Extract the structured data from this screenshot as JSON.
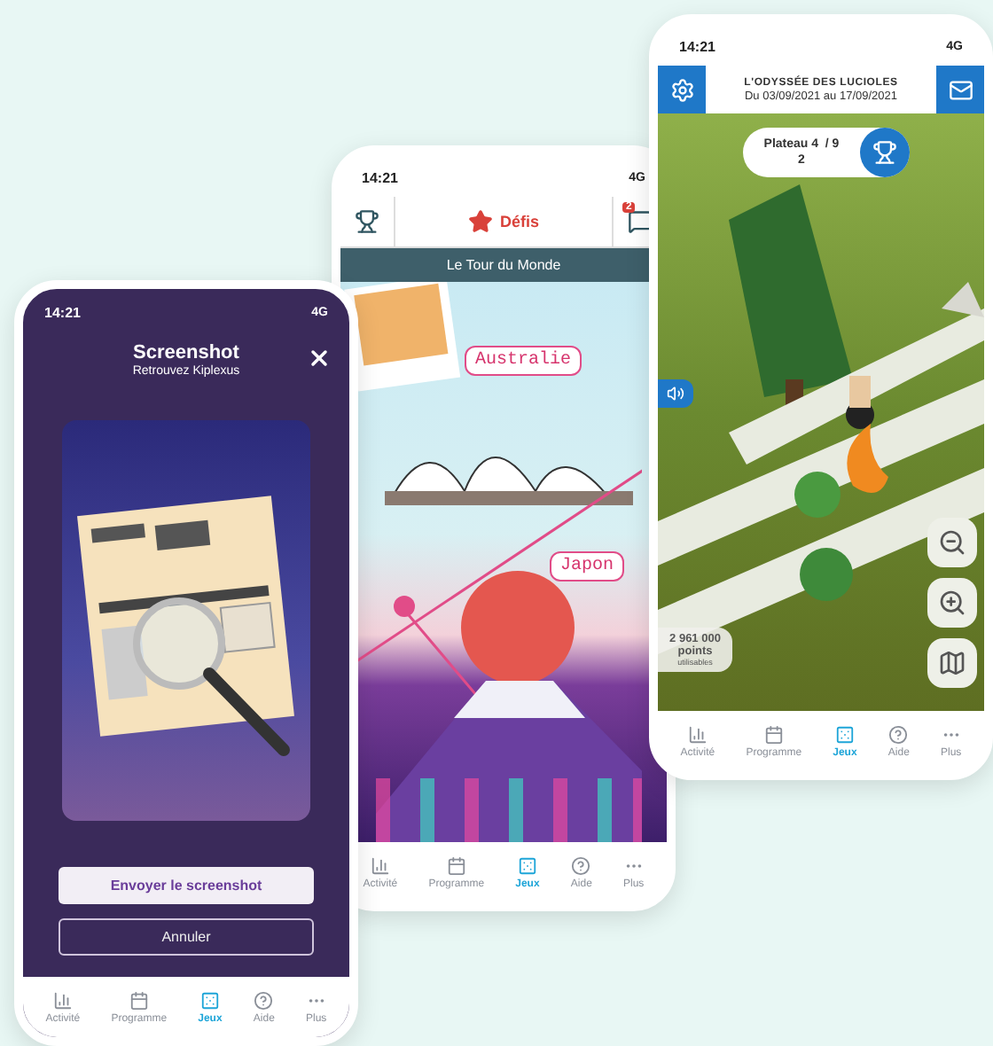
{
  "phones": [
    {
      "kind": "screenshot",
      "time": "14:21",
      "network": "4G",
      "title": "Screenshot",
      "subtitle": "Retrouvez Kiplexus",
      "primary_button": "Envoyer le screenshot",
      "secondary_button": "Annuler",
      "nav": [
        {
          "kind": "activity",
          "label": "Activité",
          "selected": false
        },
        {
          "kind": "program",
          "label": "Programme",
          "selected": false
        },
        {
          "kind": "games",
          "label": "Jeux",
          "selected": true
        },
        {
          "kind": "help",
          "label": "Aide",
          "selected": false
        },
        {
          "kind": "more",
          "label": "Plus",
          "selected": false
        }
      ]
    },
    {
      "kind": "challenges",
      "time": "14:21",
      "network": "4G",
      "tab": "Défis",
      "message_count": "2",
      "banner": "Le Tour du Monde",
      "places": [
        "Australie",
        "Japon"
      ],
      "nav": [
        {
          "kind": "activity",
          "label": "Activité",
          "selected": false
        },
        {
          "kind": "program",
          "label": "Programme",
          "selected": false
        },
        {
          "kind": "games",
          "label": "Jeux",
          "selected": true
        },
        {
          "kind": "help",
          "label": "Aide",
          "selected": false
        },
        {
          "kind": "more",
          "label": "Plus",
          "selected": false
        }
      ]
    },
    {
      "kind": "board",
      "time": "14:21",
      "network": "4G",
      "title": "L'ODYSSÉE DES LUCIOLES",
      "dates": "Du 03/09/2021 au 17/09/2021",
      "plateau": "Plateau 4  / 9",
      "fireflies": "2",
      "points": "2 961 000",
      "points_label": "points",
      "points_note": "utilisables",
      "nav": [
        {
          "kind": "activity",
          "label": "Activité",
          "selected": false
        },
        {
          "kind": "program",
          "label": "Programme",
          "selected": false
        },
        {
          "kind": "games",
          "label": "Jeux",
          "selected": true
        },
        {
          "kind": "help",
          "label": "Aide",
          "selected": false
        },
        {
          "kind": "more",
          "label": "Plus",
          "selected": false
        }
      ]
    }
  ]
}
